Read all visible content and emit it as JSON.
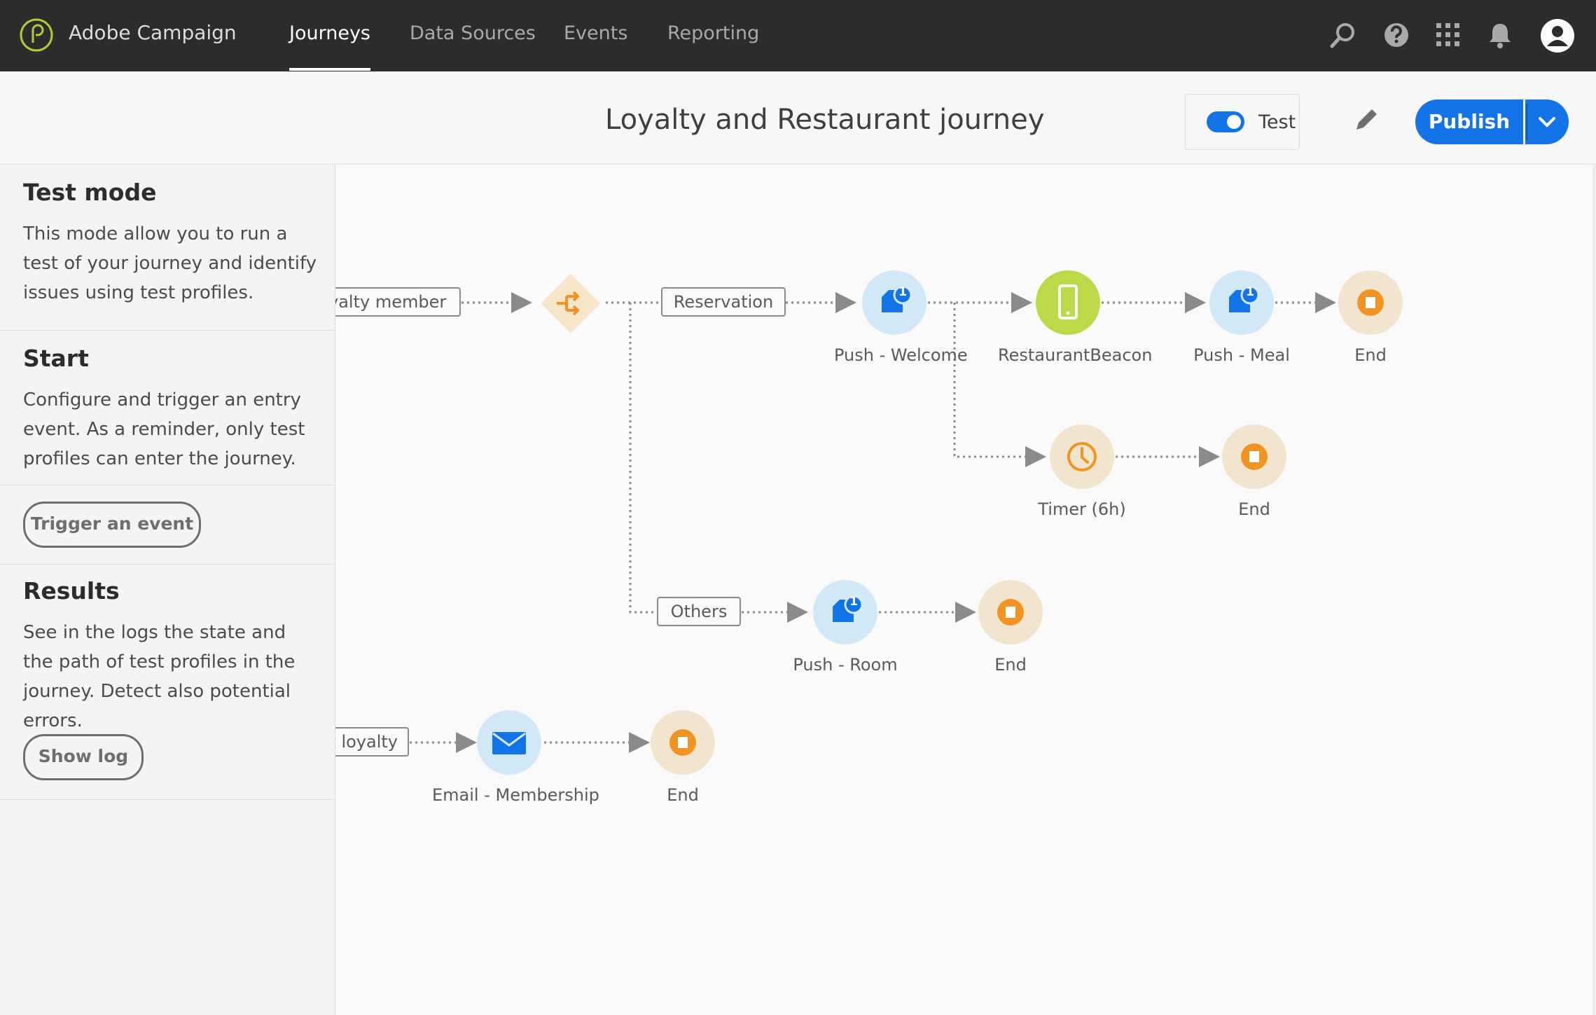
{
  "app": {
    "brand": "Adobe Campaign"
  },
  "nav": {
    "tabs": [
      {
        "label": "Journeys",
        "active": true
      },
      {
        "label": "Data Sources",
        "active": false
      },
      {
        "label": "Events",
        "active": false
      },
      {
        "label": "Reporting",
        "active": false
      }
    ],
    "icons": [
      "search-icon",
      "help-icon",
      "apps-grid-icon",
      "bell-icon",
      "user-avatar-icon"
    ]
  },
  "header": {
    "title": "Loyalty and Restaurant journey",
    "test_toggle": {
      "label": "Test",
      "on": true
    },
    "publish_label": "Publish"
  },
  "panel": {
    "test_mode": {
      "title": "Test mode",
      "text": "This mode allow you to run a test of your journey and identify issues using test profiles."
    },
    "start": {
      "title": "Start",
      "text": "Configure and trigger an entry event. As a reminder, only test profiles can enter the journey.",
      "button": "Trigger an event"
    },
    "results": {
      "title": "Results",
      "text": "See in the logs the state and the path of test profiles in the journey. Detect also potential errors.",
      "button": "Show log"
    }
  },
  "canvas": {
    "labels": {
      "loyalty_member": "yalty member",
      "reservation": "Reservation",
      "others": "Others",
      "loyalty": "t loyalty"
    },
    "nodes": {
      "push_welcome": {
        "label": "Push - Welcome",
        "badge": "1"
      },
      "restaurant_beacon": {
        "label": "RestaurantBeacon"
      },
      "push_meal": {
        "label": "Push - Meal",
        "badge": "1"
      },
      "end_1": {
        "label": "End"
      },
      "timer": {
        "label": "Timer (6h)"
      },
      "end_2": {
        "label": "End"
      },
      "push_room": {
        "label": "Push - Room",
        "badge": "1"
      },
      "end_3": {
        "label": "End"
      },
      "email_membership": {
        "label": "Email - Membership"
      },
      "end_4": {
        "label": "End"
      }
    }
  },
  "colors": {
    "accent": "#1473e6",
    "action_node": "#d3e8f7",
    "end_node": "#f1e6cd",
    "end_icon": "#f29423",
    "beacon_node": "#bcd94a",
    "condition_node": "#f5e7c8"
  }
}
